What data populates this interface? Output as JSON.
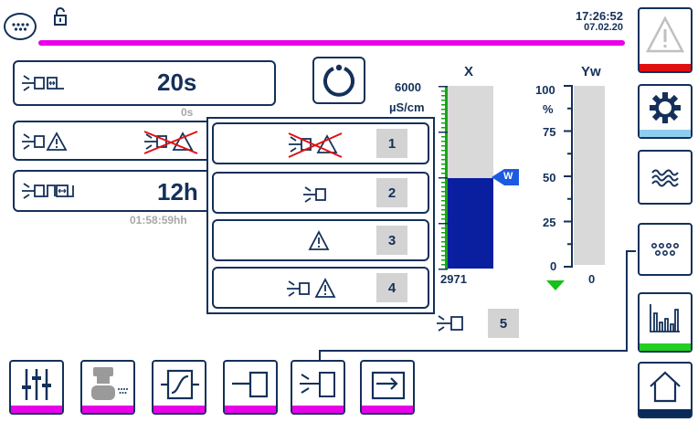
{
  "header": {
    "time": "17:26:52",
    "date": "07.02.20",
    "progress": 1.0,
    "progress_color": "#e800e8",
    "icons": [
      "dots-menu-icon",
      "unlock-icon"
    ]
  },
  "left_panel": {
    "timer_value": "20s",
    "timer_sub": "0s",
    "status_value": "12h",
    "status_sub": "01:58:59hh"
  },
  "popup": {
    "options": [
      {
        "number": "1",
        "icon": "light-off-warning-off-icon"
      },
      {
        "number": "2",
        "icon": "light-icon"
      },
      {
        "number": "3",
        "icon": "warning-icon"
      },
      {
        "number": "4",
        "icon": "light-warning-icon"
      }
    ],
    "extra_number": "5"
  },
  "gauge_x": {
    "title": "X",
    "unit": "µS/cm",
    "max_label": "6000",
    "value": 2971,
    "value_label": "2971",
    "max": 6000,
    "setpoint_label": "W",
    "setpoint_fraction": 0.5,
    "fill_color": "#0a1ea0",
    "empty_color": "#d9d9d9",
    "scale_color": "#1aa31a"
  },
  "gauge_yw": {
    "title": "Yw",
    "unit": "%",
    "ticks": [
      "100",
      "75",
      "50",
      "25",
      "0"
    ],
    "value": 0,
    "value_label": "0"
  },
  "sidebar": {
    "items": [
      {
        "name": "alarm",
        "icon": "warning-icon",
        "stripe": "#e01010"
      },
      {
        "name": "settings",
        "icon": "gear-icon",
        "stripe": "#8ecdf0"
      },
      {
        "name": "process",
        "icon": "waves-icon",
        "stripe": "#ffffff"
      },
      {
        "name": "io",
        "icon": "dots-icon",
        "stripe": "#ffffff"
      },
      {
        "name": "charts",
        "icon": "bar-chart-icon",
        "stripe": "#22d022"
      },
      {
        "name": "home",
        "icon": "home-icon",
        "stripe": "#0a2a5a"
      }
    ]
  },
  "bottom_bar": {
    "items": [
      {
        "name": "sliders",
        "icon": "sliders-icon"
      },
      {
        "name": "valve",
        "icon": "valve-icon"
      },
      {
        "name": "controller",
        "icon": "controller-icon"
      },
      {
        "name": "actuator",
        "icon": "actuator-icon"
      },
      {
        "name": "light-actuator",
        "icon": "light-actuator-icon"
      },
      {
        "name": "output",
        "icon": "output-arrow-icon"
      }
    ]
  }
}
